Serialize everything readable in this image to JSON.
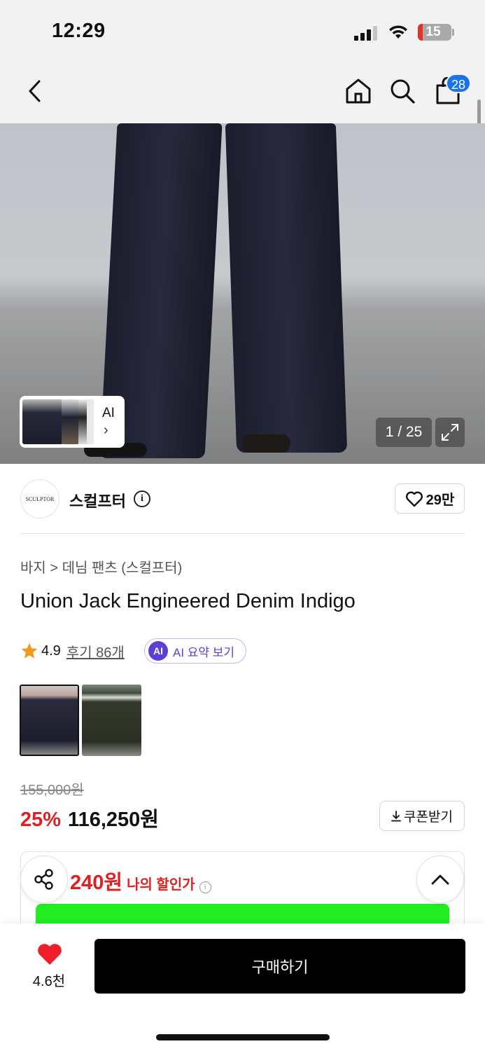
{
  "status_bar": {
    "time": "12:29",
    "battery": "15"
  },
  "nav": {
    "cart_count": "28"
  },
  "gallery": {
    "counter": "1 / 25",
    "ai_label": "AI",
    "ai_arrow": "›"
  },
  "brand": {
    "logo_text": "SCULPTOR",
    "name": "스컬프터",
    "likes": "29만"
  },
  "product": {
    "breadcrumb": "바지 > 데님 팬츠 (스컬프터)",
    "title": "Union Jack Engineered Denim Indigo",
    "rating": "4.9",
    "reviews": "후기 86개",
    "ai_badge": "AI",
    "ai_summary": "AI 요약 보기"
  },
  "price": {
    "original": "155,000원",
    "discount": "25%",
    "sale": "116,250원",
    "coupon_label": "쿠폰받기"
  },
  "promo": {
    "my_discount_amount": "240원",
    "my_discount_label": "나의 할인가"
  },
  "bottom": {
    "like_count": "4.6천",
    "buy_label": "구매하기"
  },
  "colors": {
    "accent_red": "#e02020",
    "ai_purple": "#5b3fd6",
    "badge_blue": "#1a73e8"
  }
}
